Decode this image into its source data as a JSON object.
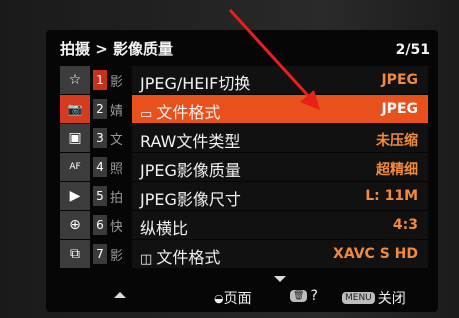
{
  "header": {
    "breadcrumb": "拍摄 > 影像质量",
    "page": "2/51"
  },
  "tabs": [
    {
      "icon": "star-icon",
      "glyph": "☆"
    },
    {
      "icon": "camera-icon",
      "glyph": "📷",
      "active": true
    },
    {
      "icon": "playback-image-icon",
      "glyph": "▣"
    },
    {
      "icon": "af-mf-icon",
      "glyph": "AF"
    },
    {
      "icon": "play-icon",
      "glyph": "▶"
    },
    {
      "icon": "globe-icon",
      "glyph": "⊕"
    },
    {
      "icon": "toolbox-icon",
      "glyph": "⧉"
    }
  ],
  "categories": [
    {
      "num": "1",
      "text": "影"
    },
    {
      "num": "2",
      "text": "婧"
    },
    {
      "num": "3",
      "text": "文"
    },
    {
      "num": "4",
      "text": "照"
    },
    {
      "num": "5",
      "text": "拍"
    },
    {
      "num": "6",
      "text": "快"
    },
    {
      "num": "7",
      "text": "影"
    }
  ],
  "items": [
    {
      "label": "JPEG/HEIF切换",
      "value": "JPEG"
    },
    {
      "label": "文件格式",
      "value": "JPEG",
      "highlight": true
    },
    {
      "label": "RAW文件类型",
      "value": "未压缩"
    },
    {
      "label": "JPEG影像质量",
      "value": "超精细"
    },
    {
      "label": "JPEG影像尺寸",
      "value": "L: 11M"
    },
    {
      "label": "纵横比",
      "value": "4:3"
    },
    {
      "label": "文件格式",
      "value": "XAVC S HD"
    }
  ],
  "footer": {
    "page_label": "页面",
    "help_label": "?",
    "close_key": "MENU",
    "close_label": "关闭"
  },
  "colors": {
    "accent": "#e8501c",
    "value": "#f08a3c",
    "tab_active": "#d63a1f"
  }
}
